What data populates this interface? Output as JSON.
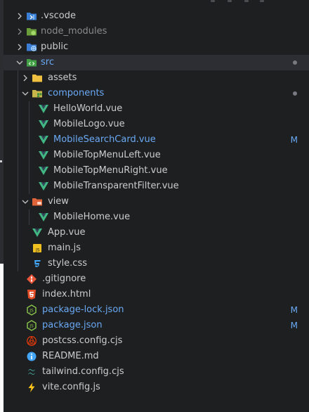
{
  "explorer": {
    "items": [
      {
        "label": "vscode",
        "name": "vscode-folder"
      },
      {
        "label": "node_modules",
        "name": "node-modules-folder"
      },
      {
        "label": "public",
        "name": "public-folder"
      },
      {
        "label": "src",
        "name": "src-folder"
      },
      {
        "label": "assets",
        "name": "assets-folder"
      },
      {
        "label": "components",
        "name": "components-folder"
      },
      {
        "label": "HelloWorld.vue",
        "name": "helloworld-vue"
      },
      {
        "label": "MobileLogo.vue",
        "name": "mobilelogo-vue"
      },
      {
        "label": "MobileSearchCard.vue",
        "name": "mobilesearchcard-vue",
        "badge": "M"
      },
      {
        "label": "MobileTopMenuLeft.vue",
        "name": "mobiletopmenuleft-vue"
      },
      {
        "label": "MobileTopMenuRight.vue",
        "name": "mobiletopmenuright-vue"
      },
      {
        "label": "MobileTransparentFilter.vue",
        "name": "mobiletransparentfilter-vue"
      },
      {
        "label": "view",
        "name": "view-folder"
      },
      {
        "label": "MobileHome.vue",
        "name": "mobilehome-vue"
      },
      {
        "label": "App.vue",
        "name": "app-vue"
      },
      {
        "label": "main.js",
        "name": "main-js"
      },
      {
        "label": "style.css",
        "name": "style-css"
      },
      {
        "label": ".gitignore",
        "name": "gitignore"
      },
      {
        "label": "index.html",
        "name": "index-html"
      },
      {
        "label": "package-lock.json",
        "name": "package-lock-json",
        "badge": "M"
      },
      {
        "label": "package.json",
        "name": "package-json",
        "badge": "M"
      },
      {
        "label": "postcss.config.cjs",
        "name": "postcss-config"
      },
      {
        "label": "README.md",
        "name": "readme-md"
      },
      {
        "label": "tailwind.config.cjs",
        "name": "tailwind-config"
      },
      {
        "label": "vite.config.js",
        "name": "vite-config"
      }
    ]
  },
  "colors": {
    "background": "#1e1f21",
    "modified": "#6aa9f4",
    "vue": "#41b883",
    "folder": "#f0c040"
  }
}
